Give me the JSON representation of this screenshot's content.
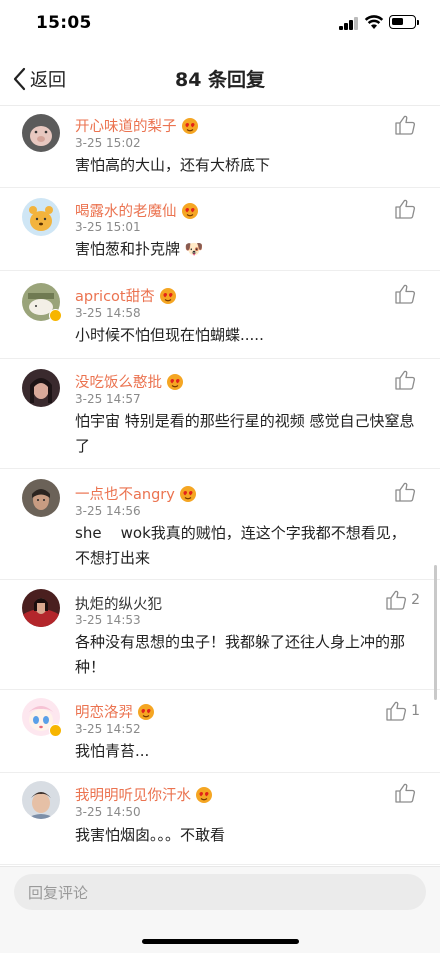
{
  "status_bar": {
    "time": "15:05"
  },
  "nav": {
    "back_label": "返回",
    "title": "84 条回复"
  },
  "comments": [
    {
      "name": "开心味道的梨子",
      "highlight": true,
      "has_emoji": true,
      "time": "3-25 15:02",
      "text": "害怕高的大山，还有大桥底下",
      "likes": "",
      "avatar_icon": "pig-avatar"
    },
    {
      "name": "喝露水的老魔仙",
      "highlight": true,
      "has_emoji": true,
      "time": "3-25 15:01",
      "text": "害怕葱和扑克牌 🐶",
      "likes": "",
      "avatar_icon": "pooh-avatar"
    },
    {
      "name": "apricot甜杏",
      "highlight": true,
      "has_emoji": true,
      "verified": true,
      "time": "3-25 14:58",
      "text": "小时候不怕但现在怕蝴蝶.....",
      "likes": "",
      "avatar_icon": "sheep-avatar"
    },
    {
      "name": "没吃饭么憨批",
      "highlight": true,
      "has_emoji": true,
      "time": "3-25 14:57",
      "text": "怕宇宙 特别是看的那些行星的视频 感觉自己快窒息了",
      "likes": "",
      "avatar_icon": "girl-avatar"
    },
    {
      "name": "一点也不angry",
      "highlight": true,
      "has_emoji": true,
      "time": "3-25 14:56",
      "text": "she    wok我真的贼怕，连这个字我都不想看见，不想打出来",
      "likes": "",
      "avatar_icon": "man-avatar"
    },
    {
      "name": "执炬的纵火犯",
      "highlight": false,
      "has_emoji": false,
      "time": "3-25 14:53",
      "text": "各种没有思想的虫子！我都躲了还往人身上冲的那种！",
      "likes": "2",
      "avatar_icon": "red-avatar"
    },
    {
      "name": "明恋洛羿",
      "highlight": true,
      "has_emoji": true,
      "verified": true,
      "time": "3-25 14:52",
      "text": "我怕青苔...",
      "likes": "1",
      "avatar_icon": "anime-avatar"
    },
    {
      "name": "我明明听见你汗水",
      "highlight": true,
      "has_emoji": true,
      "time": "3-25 14:50",
      "text": "我害怕烟囱。。。不敢看",
      "likes": "",
      "avatar_icon": "kid-avatar"
    }
  ],
  "bottom": {
    "reply_placeholder": "回复评论"
  },
  "colors": {
    "name_accent": "#eb7350",
    "verified_badge": "#f7b500"
  }
}
